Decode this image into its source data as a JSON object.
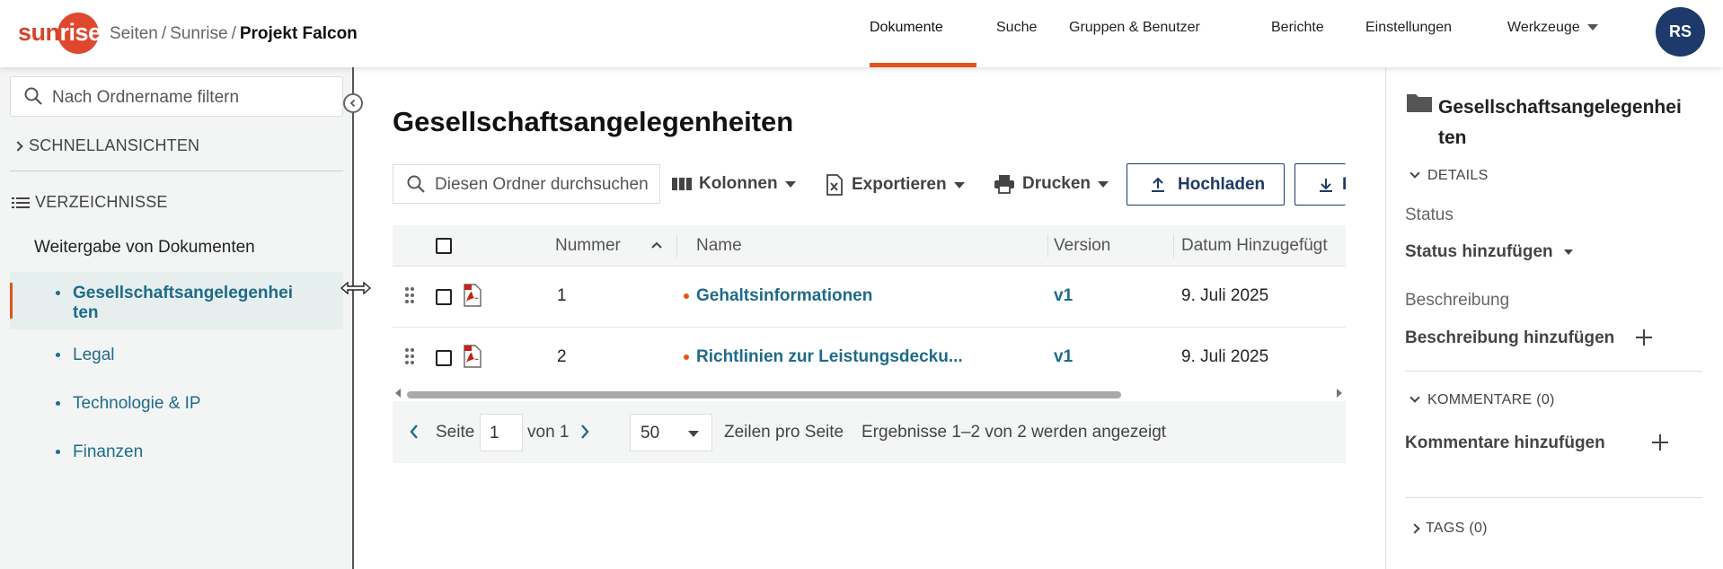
{
  "header": {
    "logo_part1": "sun",
    "logo_part2": "rise",
    "breadcrumb": [
      "Seiten",
      "Sunrise",
      "Projekt Falcon"
    ],
    "nav": [
      "Dokumente",
      "Suche",
      "Gruppen & Benutzer",
      "Berichte",
      "Einstellungen",
      "Werkzeuge"
    ],
    "active_nav": "Dokumente",
    "avatar": "RS",
    "accent_color": "#e5531c",
    "avatar_color": "#1e3a6b"
  },
  "sidebar": {
    "filter_placeholder": "Nach Ordnername filtern",
    "quick_views": "SCHNELLANSICHTEN",
    "directories": "VERZEICHNISSE",
    "share_docs": "Weitergabe von Dokumenten",
    "items": [
      {
        "label_line1": "Gesellschaftsangelegenhei",
        "label_line2": "ten",
        "selected": true
      },
      {
        "label": "Legal"
      },
      {
        "label": "Technologie & IP"
      },
      {
        "label": "Finanzen"
      }
    ]
  },
  "main": {
    "title": "Gesellschaftsangelegenheiten",
    "search_placeholder": "Diesen Ordner durchsuchen",
    "toolbar": {
      "columns": "Kolonnen",
      "export": "Exportieren",
      "print": "Drucken",
      "upload": "Hochladen",
      "download_partial": "D"
    },
    "table": {
      "headers": {
        "number": "Nummer",
        "name": "Name",
        "version": "Version",
        "date_added": "Datum Hinzugefügt"
      },
      "rows": [
        {
          "number": "1",
          "name": "Gehaltsinformationen",
          "version": "v1",
          "date": "9. Juli 2025",
          "type": "pdf"
        },
        {
          "number": "2",
          "name": "Richtlinien zur Leistungsdecku...",
          "version": "v1",
          "date": "9. Juli 2025",
          "type": "pdf"
        }
      ]
    },
    "pager": {
      "page_label": "Seite",
      "page_value": "1",
      "of_label": "von 1",
      "rows_value": "50",
      "rows_label": "Zeilen pro Seite",
      "results": "Ergebnisse 1–2 von 2 werden angezeigt"
    }
  },
  "right_panel": {
    "title_line1": "Gesellschaftsangelegenhei",
    "title_line2": "ten",
    "details": "DETAILS",
    "status_label": "Status",
    "status_add": "Status hinzufügen",
    "description_label": "Beschreibung",
    "description_add": "Beschreibung hinzufügen",
    "comments": "KOMMENTARE (0)",
    "comments_add": "Kommentare hinzufügen",
    "tags": "TAGS (0)"
  }
}
